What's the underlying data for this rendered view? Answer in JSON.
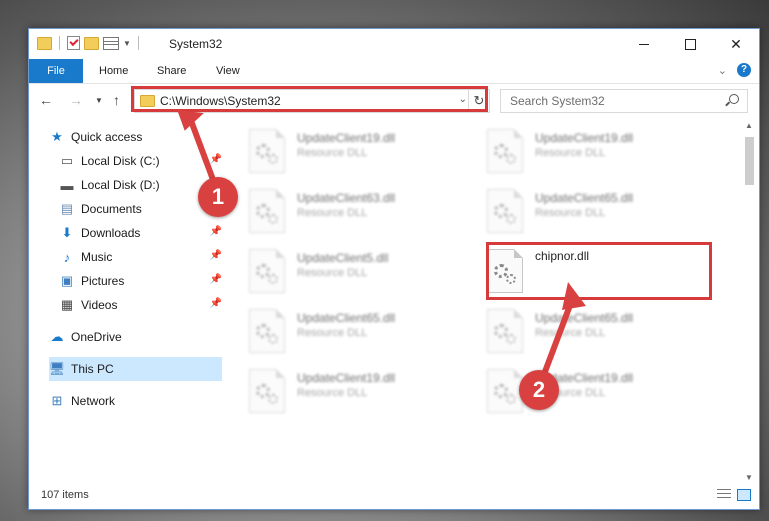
{
  "window": {
    "title": "System32"
  },
  "ribbon": {
    "tabs": [
      {
        "label": "File"
      },
      {
        "label": "Home"
      },
      {
        "label": "Share"
      },
      {
        "label": "View"
      }
    ]
  },
  "address": {
    "path": "C:\\Windows\\System32"
  },
  "search": {
    "placeholder": "Search System32"
  },
  "sidebar": {
    "items": [
      {
        "label": "Quick access",
        "icon": "star-icon"
      },
      {
        "label": "Local Disk (C:)",
        "icon": "drive-icon"
      },
      {
        "label": "Local Disk (D:)",
        "icon": "drive-icon"
      },
      {
        "label": "Documents",
        "icon": "documents-icon"
      },
      {
        "label": "Downloads",
        "icon": "download-icon"
      },
      {
        "label": "Music",
        "icon": "music-icon"
      },
      {
        "label": "Pictures",
        "icon": "pictures-icon"
      },
      {
        "label": "Videos",
        "icon": "videos-icon"
      },
      {
        "label": "OneDrive",
        "icon": "cloud-icon"
      },
      {
        "label": "This PC",
        "icon": "computer-icon"
      },
      {
        "label": "Network",
        "icon": "network-icon"
      }
    ]
  },
  "files": [
    {
      "name": "UpdateClient19.dll",
      "type": "Resource DLL"
    },
    {
      "name": "UpdateClient19.dll",
      "type": "Resource DLL"
    },
    {
      "name": "UpdateClient63.dll",
      "type": "Resource DLL"
    },
    {
      "name": "UpdateClient65.dll",
      "type": "Resource DLL"
    },
    {
      "name": "UpdateClient5.dll",
      "type": "Resource DLL"
    },
    {
      "name": "chipnor.dll",
      "type": ""
    },
    {
      "name": "UpdateClient65.dll",
      "type": "Resource DLL"
    },
    {
      "name": "UpdateClient65.dll",
      "type": "Resource DLL"
    },
    {
      "name": "UpdateClient19.dll",
      "type": "Resource DLL"
    },
    {
      "name": "UpdateClient19.dll",
      "type": "Resource DLL"
    }
  ],
  "status": {
    "count": "107 items"
  },
  "annotations": {
    "step1": "1",
    "step2": "2",
    "color": "#d94040"
  }
}
